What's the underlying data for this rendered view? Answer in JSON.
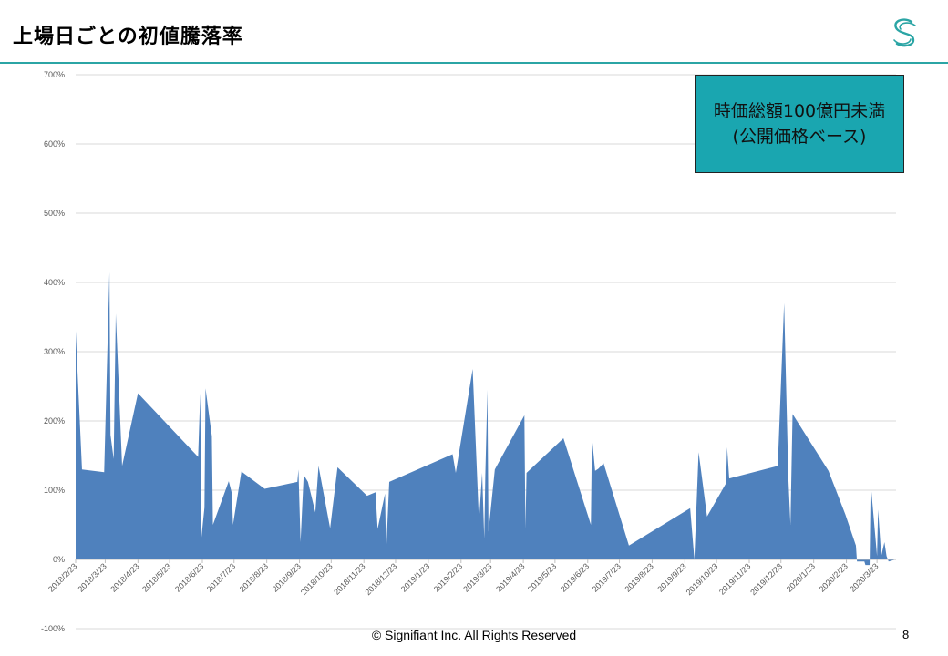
{
  "slide": {
    "title": "上場日ごとの初値騰落率",
    "callout_line1": "時価総額100億円未満",
    "callout_line2": "(公開価格ベース)",
    "copyright": "© Signifiant Inc. All Rights Reserved",
    "page_number": "8",
    "accent_color": "#2ba5a5"
  },
  "chart_data": {
    "type": "area",
    "title": "",
    "xlabel": "",
    "ylabel": "",
    "ylim": [
      -100,
      700
    ],
    "y_ticks": [
      -100,
      0,
      100,
      200,
      300,
      400,
      500,
      600,
      700
    ],
    "y_tick_labels": [
      "-100%",
      "0%",
      "100%",
      "200%",
      "300%",
      "400%",
      "500%",
      "600%",
      "700%"
    ],
    "x_ticks": [
      "2018/2/23",
      "2018/3/23",
      "2018/4/23",
      "2018/5/23",
      "2018/6/23",
      "2018/7/23",
      "2018/8/23",
      "2018/9/23",
      "2018/10/23",
      "2018/11/23",
      "2018/12/23",
      "2019/1/23",
      "2019/2/23",
      "2019/3/23",
      "2019/4/23",
      "2019/5/23",
      "2019/6/23",
      "2019/7/23",
      "2019/8/23",
      "2019/9/23",
      "2019/10/23",
      "2019/11/23",
      "2019/12/23",
      "2020/1/23",
      "2020/2/23",
      "2020/3/23"
    ],
    "x_range": [
      "2018/2/23",
      "2020/4/10"
    ],
    "color": "#4f81bd",
    "grid": true,
    "series": [
      {
        "points": [
          [
            "2018/2/23",
            330
          ],
          [
            "2018/3/1",
            130
          ],
          [
            "2018/3/22",
            126
          ],
          [
            "2018/3/27",
            415
          ],
          [
            "2018/3/28",
            180
          ],
          [
            "2018/3/31",
            145
          ],
          [
            "2018/4/2",
            355
          ],
          [
            "2018/4/8",
            135
          ],
          [
            "2018/4/23",
            240
          ],
          [
            "2018/6/19",
            148
          ],
          [
            "2018/6/21",
            240
          ],
          [
            "2018/6/22",
            30
          ],
          [
            "2018/6/25",
            75
          ],
          [
            "2018/6/26",
            247
          ],
          [
            "2018/7/2",
            178
          ],
          [
            "2018/7/3",
            50
          ],
          [
            "2018/7/18",
            113
          ],
          [
            "2018/7/21",
            95
          ],
          [
            "2018/7/22",
            50
          ],
          [
            "2018/7/30",
            127
          ],
          [
            "2018/8/21",
            102
          ],
          [
            "2018/9/21",
            112
          ],
          [
            "2018/9/22",
            130
          ],
          [
            "2018/9/24",
            25
          ],
          [
            "2018/9/27",
            122
          ],
          [
            "2018/10/1",
            112
          ],
          [
            "2018/10/8",
            68
          ],
          [
            "2018/10/11",
            135
          ],
          [
            "2018/10/22",
            45
          ],
          [
            "2018/10/29",
            133
          ],
          [
            "2018/11/26",
            92
          ],
          [
            "2018/12/4",
            97
          ],
          [
            "2018/12/6",
            44
          ],
          [
            "2018/12/13",
            95
          ],
          [
            "2018/12/14",
            8
          ],
          [
            "2018/12/17",
            112
          ],
          [
            "2019/2/15",
            152
          ],
          [
            "2019/2/18",
            125
          ],
          [
            "2019/3/6",
            275
          ],
          [
            "2019/3/12",
            55
          ],
          [
            "2019/3/15",
            125
          ],
          [
            "2019/3/17",
            30
          ],
          [
            "2019/3/18",
            122
          ],
          [
            "2019/3/20",
            245
          ],
          [
            "2019/3/21",
            40
          ],
          [
            "2019/3/27",
            130
          ],
          [
            "2019/4/24",
            208
          ],
          [
            "2019/4/25",
            44
          ],
          [
            "2019/4/26",
            125
          ],
          [
            "2019/5/31",
            175
          ],
          [
            "2019/6/26",
            50
          ],
          [
            "2019/6/27",
            177
          ],
          [
            "2019/6/30",
            128
          ],
          [
            "2019/7/3",
            131
          ],
          [
            "2019/7/8",
            139
          ],
          [
            "2019/8/1",
            20
          ],
          [
            "2019/9/28",
            74
          ],
          [
            "2019/10/2",
            0
          ],
          [
            "2019/10/6",
            155
          ],
          [
            "2019/10/14",
            62
          ],
          [
            "2019/11/1",
            110
          ],
          [
            "2019/11/2",
            162
          ],
          [
            "2019/11/4",
            117
          ],
          [
            "2019/12/20",
            135
          ],
          [
            "2019/12/26",
            370
          ],
          [
            "2019/12/30",
            118
          ],
          [
            "2020/1/1",
            50
          ],
          [
            "2020/1/3",
            210
          ],
          [
            "2020/2/6",
            128
          ],
          [
            "2020/2/22",
            65
          ],
          [
            "2020/3/3",
            20
          ],
          [
            "2020/3/4",
            -3
          ],
          [
            "2020/3/11",
            -3
          ],
          [
            "2020/3/12",
            -8
          ],
          [
            "2020/3/16",
            -8
          ],
          [
            "2020/3/17",
            110
          ],
          [
            "2020/3/23",
            5
          ],
          [
            "2020/3/24",
            72
          ],
          [
            "2020/3/27",
            5
          ],
          [
            "2020/3/30",
            25
          ],
          [
            "2020/4/1",
            5
          ],
          [
            "2020/4/3",
            -3
          ],
          [
            "2020/4/10",
            0
          ]
        ]
      }
    ]
  }
}
